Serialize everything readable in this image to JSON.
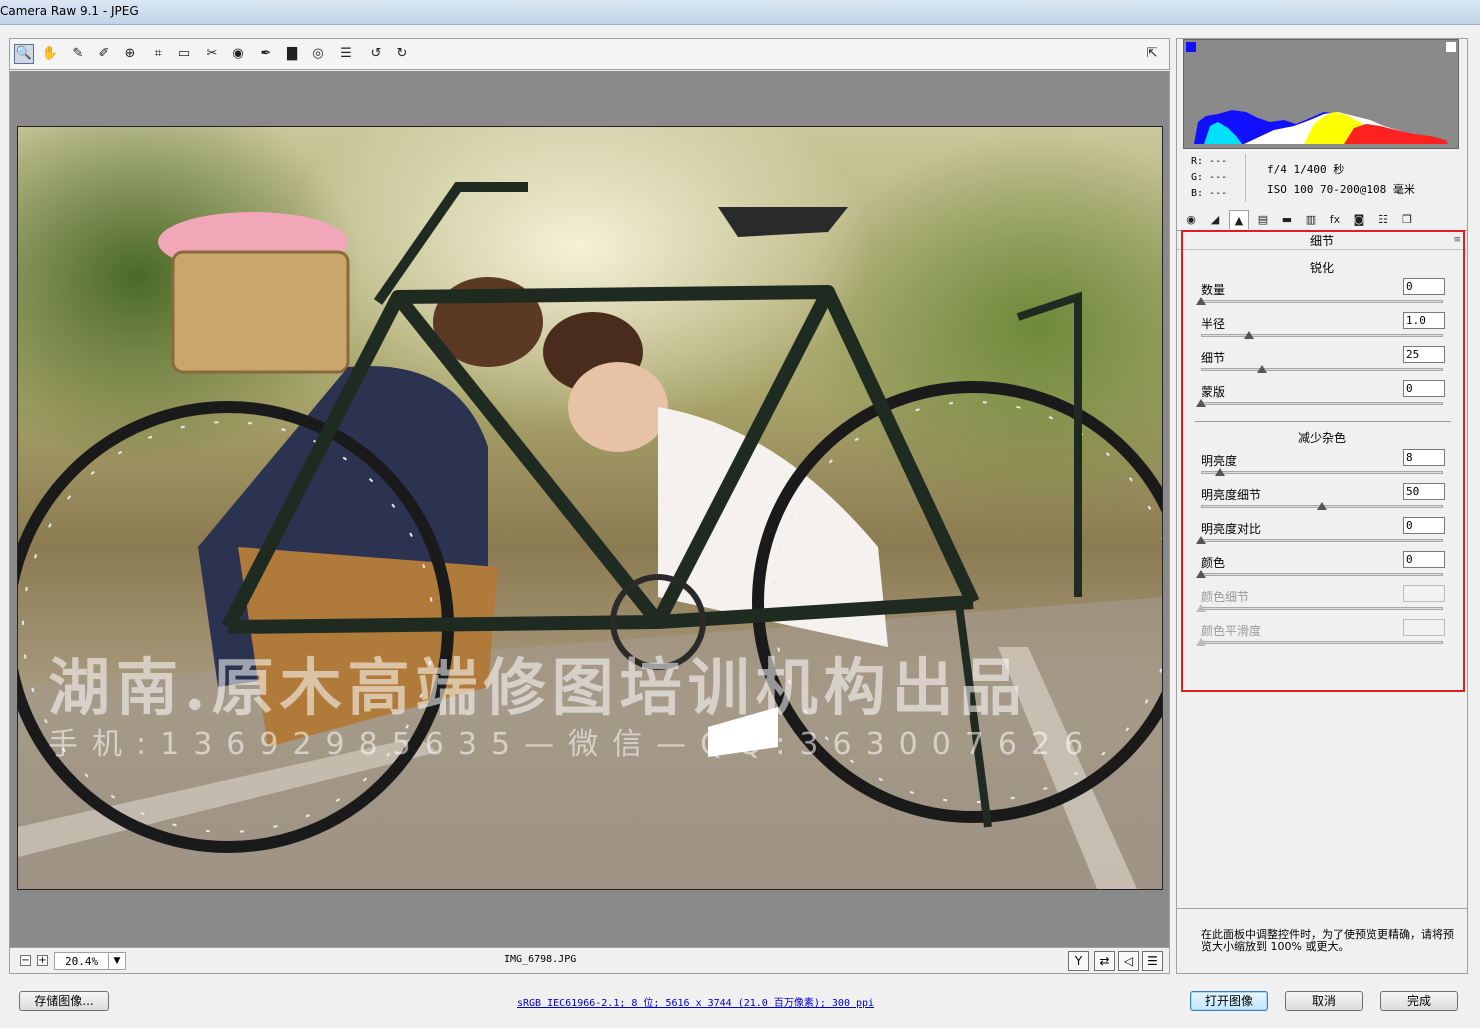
{
  "window": {
    "title": "Camera Raw 9.1 -  JPEG"
  },
  "toolbar": {
    "tools": [
      {
        "name": "zoom-tool-icon",
        "glyph": "🔍"
      },
      {
        "name": "hand-tool-icon",
        "glyph": "✋"
      },
      {
        "name": "white-balance-tool-icon",
        "glyph": "✎"
      },
      {
        "name": "color-sampler-tool-icon",
        "glyph": "✐"
      },
      {
        "name": "targeted-adjustment-tool-icon",
        "glyph": "⊕"
      },
      {
        "name": "crop-tool-icon",
        "glyph": "⌗"
      },
      {
        "name": "straighten-tool-icon",
        "glyph": "▭"
      },
      {
        "name": "spot-removal-tool-icon",
        "glyph": "✂"
      },
      {
        "name": "red-eye-removal-icon",
        "glyph": "◉"
      },
      {
        "name": "adjustment-brush-icon",
        "glyph": "✒"
      },
      {
        "name": "graduated-filter-icon",
        "glyph": "▇"
      },
      {
        "name": "radial-filter-icon",
        "glyph": "◎"
      },
      {
        "name": "preferences-icon",
        "glyph": "☰"
      },
      {
        "name": "rotate-ccw-icon",
        "glyph": "↺"
      },
      {
        "name": "rotate-cw-icon",
        "glyph": "↻"
      }
    ],
    "fullscreen_glyph": "⇱"
  },
  "preview": {
    "watermark_line1": "湖南.原木高端修图培训机构出品",
    "watermark_line2": "手机:13692985635—微信—QQ:363007626"
  },
  "statusbar": {
    "zoom_minus": "−",
    "zoom_plus": "+",
    "zoom_value": "20.4%",
    "zoom_dropdown": "▼",
    "filename": "IMG_6798.JPG",
    "icons": [
      {
        "name": "before-after-y-icon",
        "glyph": "Y"
      },
      {
        "name": "swap-settings-icon",
        "glyph": "⇄"
      },
      {
        "name": "copy-settings-icon",
        "glyph": "◁"
      },
      {
        "name": "preview-preferences-icon",
        "glyph": "☰"
      }
    ]
  },
  "histogram_colors": {
    "red": "#ff2020",
    "yellow": "#ffff00",
    "blue": "#1010ff",
    "cyan": "#00e0ff",
    "white": "#ffffff"
  },
  "exif": {
    "r": "R:  ---",
    "g": "G:  ---",
    "b": "B:  ---",
    "line1": "f/4   1/400 秒",
    "line2": "ISO 100   70-200@108 毫米"
  },
  "tabs": [
    {
      "name": "tab-basic-icon",
      "glyph": "◉"
    },
    {
      "name": "tab-tone-curve-icon",
      "glyph": "◢"
    },
    {
      "name": "tab-detail-icon",
      "glyph": "▲"
    },
    {
      "name": "tab-hsl-icon",
      "glyph": "▤"
    },
    {
      "name": "tab-split-toning-icon",
      "glyph": "▬"
    },
    {
      "name": "tab-lens-corrections-icon",
      "glyph": "▥"
    },
    {
      "name": "tab-effects-icon",
      "glyph": "fx"
    },
    {
      "name": "tab-camera-calibration-icon",
      "glyph": "◙"
    },
    {
      "name": "tab-presets-icon",
      "glyph": "☷"
    },
    {
      "name": "tab-snapshots-icon",
      "glyph": "❐"
    }
  ],
  "detail_panel": {
    "title": "细节",
    "sharpening_title": "锐化",
    "sharpening": [
      {
        "label": "数量",
        "value": "0",
        "level": 0
      },
      {
        "label": "半径",
        "value": "1.0",
        "level": 0.2
      },
      {
        "label": "细节",
        "value": "25",
        "level": 0.25
      },
      {
        "label": "蒙版",
        "value": "0",
        "level": 0
      }
    ],
    "noise_title": "减少杂色",
    "noise": [
      {
        "label": "明亮度",
        "value": "8",
        "level": 0.08
      },
      {
        "label": "明亮度细节",
        "value": "50",
        "level": 0.5
      },
      {
        "label": "明亮度对比",
        "value": "0",
        "level": 0
      },
      {
        "label": "颜色",
        "value": "0",
        "level": 0
      },
      {
        "label": "颜色细节",
        "value": "",
        "level": 0,
        "disabled": true
      },
      {
        "label": "颜色平滑度",
        "value": "",
        "level": 0,
        "disabled": true
      }
    ],
    "hint": "在此面板中调整控件时，为了使预览更精确，请将预览大小缩放到 100% 或更大。"
  },
  "footer": {
    "save_label": "存储图像...",
    "color_info": "sRGB IEC61966-2.1; 8 位; 5616 x 3744 (21.0 百万像素); 300 ppi",
    "open_label": "打开图像",
    "cancel_label": "取消",
    "done_label": "完成"
  }
}
